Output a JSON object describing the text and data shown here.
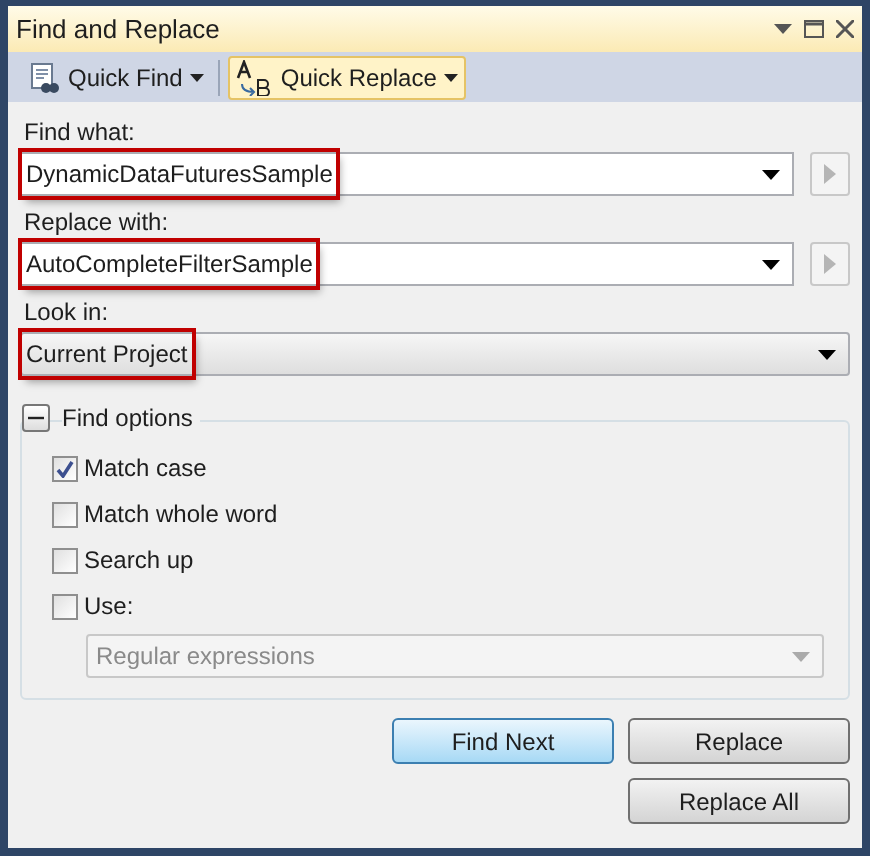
{
  "window": {
    "title": "Find and Replace"
  },
  "toolbar": [
    {
      "label": "Quick Find",
      "selected": false,
      "kind": "find"
    },
    {
      "label": "Quick Replace",
      "selected": true,
      "kind": "replace"
    }
  ],
  "fields": [
    {
      "label": "Find what:",
      "value": "DynamicDataFuturesSample",
      "highlighted": true,
      "kind": "combo-go"
    },
    {
      "label": "Replace with:",
      "value": "AutoCompleteFilterSample",
      "highlighted": true,
      "kind": "combo-go"
    },
    {
      "label": "Look in:",
      "value": "Current Project",
      "highlighted": true,
      "kind": "dropdown"
    }
  ],
  "find_options": {
    "title": "Find options",
    "expanded": true,
    "options": [
      {
        "label": "Match case",
        "checked": true
      },
      {
        "label": "Match whole word",
        "checked": false
      },
      {
        "label": "Search up",
        "checked": false
      },
      {
        "label": "Use:",
        "checked": false
      }
    ],
    "use_value": {
      "value": "Regular expressions",
      "disabled": true
    }
  },
  "buttons": [
    {
      "label": "Find Next",
      "selected": true
    },
    {
      "label": "Replace",
      "selected": false
    },
    {
      "label": "Replace All",
      "selected": false
    }
  ]
}
